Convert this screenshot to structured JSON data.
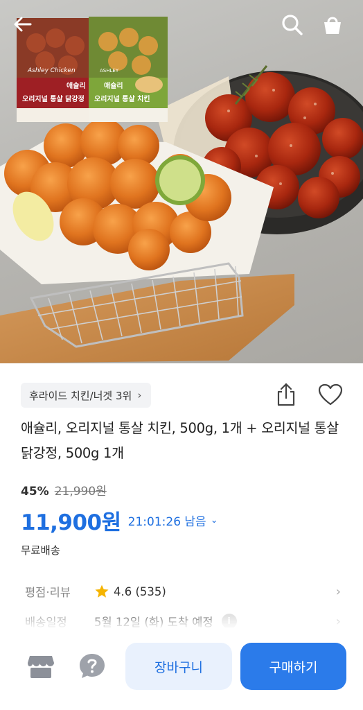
{
  "hero": {
    "packages": [
      {
        "brand_script": "Ashley Chicken",
        "name_line1": "애슐리",
        "name_line2": "오리지널 통살 닭강정",
        "color": "#9e1f24"
      },
      {
        "brand_script": "ASHLEY",
        "name_line1": "애슐리",
        "name_line2": "오리지널 통살 치킨",
        "color": "#7ea63a"
      }
    ]
  },
  "top_bar": {
    "back_icon": "arrow-left-icon",
    "search_icon": "search-icon",
    "cart_icon": "shopping-bag-icon"
  },
  "product": {
    "rank_chip": "후라이드 치킨/너겟 3위",
    "rank_chevron": "›",
    "title": "애슐리, 오리지널 통살 치킨, 500g, 1개 + 오리지널 통살 닭강정, 500g 1개",
    "discount": "45%",
    "original_price": "21,990원",
    "price": "11,900원",
    "timer": "21:01:26 남음",
    "timer_chevron": "⌄",
    "shipping": "무료배송",
    "rating_label": "평점·리뷰",
    "rating_value": "4.6 (535)",
    "delivery_label": "배송일정",
    "delivery_value": "5월 12일 (화) 도착 예정",
    "info_mark": "i",
    "row_arrow": "›"
  },
  "bottom_bar": {
    "store_icon": "store-icon",
    "help_icon": "question-icon",
    "cart_button": "장바구니",
    "buy_button": "구매하기"
  },
  "colors": {
    "accent": "#1e6fe0",
    "buy_button": "#2b7bea",
    "cart_button_bg": "#e9f1fd",
    "star": "#f5b400"
  }
}
